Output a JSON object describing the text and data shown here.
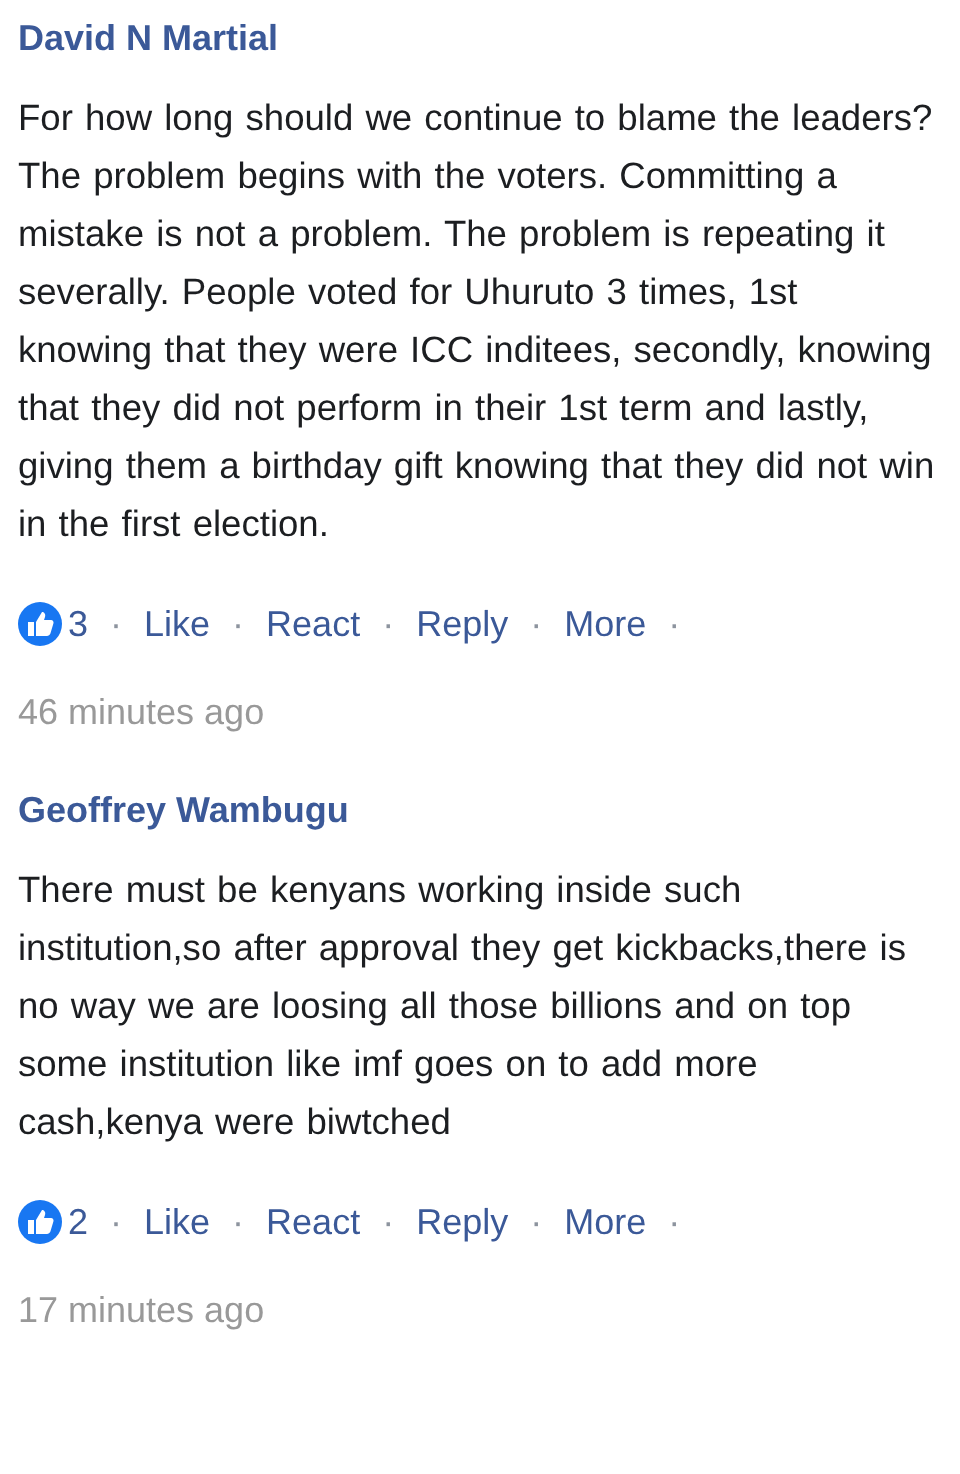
{
  "comments": [
    {
      "author": "David N Martial",
      "text": "For how long should we continue to blame the leaders? The problem begins with the voters. Committing a mistake is not a problem. The problem is repeating it severally. People voted for Uhuruto 3 times, 1st knowing that they were ICC inditees, secondly, knowing that they did not perform in their 1st term and lastly, giving them a birthday gift knowing that they did not win in the first election.",
      "like_count": "3",
      "actions": [
        "Like",
        "React",
        "Reply",
        "More"
      ],
      "time": "46 minutes ago"
    },
    {
      "author": "Geoffrey Wambugu",
      "text": "There must be kenyans working inside such institution,so after approval they get kickbacks,there is no way we are loosing all those billions and on top some institution like imf goes on to add more cash,kenya were biwtched",
      "like_count": "2",
      "actions": [
        "Like",
        "React",
        "Reply",
        "More"
      ],
      "time": "17 minutes ago"
    }
  ],
  "separator": "·"
}
